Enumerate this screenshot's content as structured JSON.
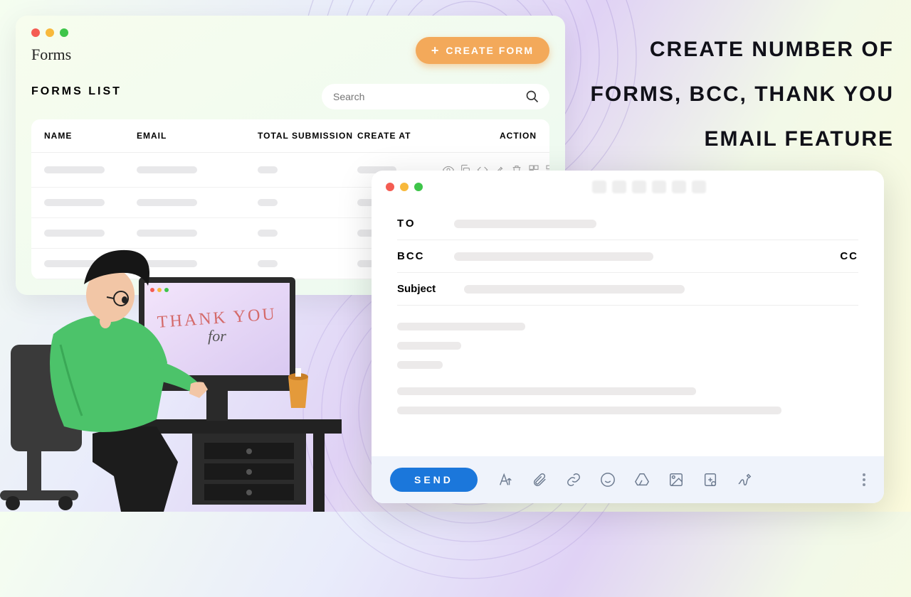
{
  "headline": "CREATE NUMBER OF FORMS, BCC, THANK YOU EMAIL FEATURE",
  "forms": {
    "title": "Forms",
    "subtitle": "FORMS LIST",
    "create_label": "CREATE FORM",
    "search_placeholder": "Search",
    "columns": {
      "name": "NAME",
      "email": "EMAIL",
      "total": "TOTAL SUBMISSION",
      "created": "CREATE AT",
      "action": "ACTION"
    }
  },
  "email": {
    "to": "TO",
    "bcc": "BCC",
    "cc": "CC",
    "subject": "Subject",
    "send": "SEND"
  },
  "monitor": {
    "thank": "THANK YOU",
    "for": "for"
  },
  "colors": {
    "accent": "#f3a95a",
    "send": "#1b77db"
  }
}
